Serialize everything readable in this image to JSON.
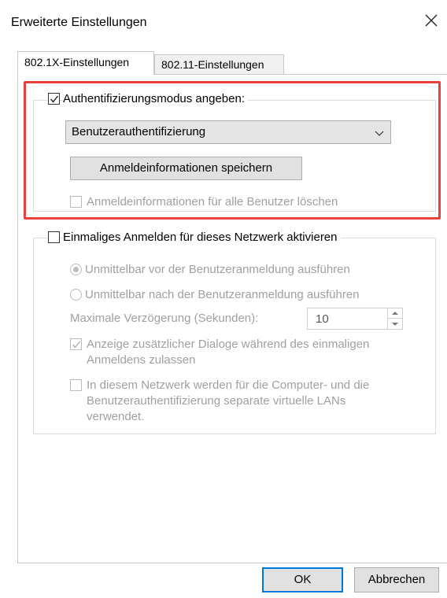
{
  "window": {
    "title": "Erweiterte Einstellungen"
  },
  "tabs": [
    {
      "label": "802.1X-Einstellungen",
      "selected": true
    },
    {
      "label": "802.11-Einstellungen",
      "selected": false
    }
  ],
  "auth_group": {
    "checkbox_label": "Authentifizierungsmodus angeben:",
    "checked": true,
    "mode_select_value": "Benutzerauthentifizierung",
    "save_button_label": "Anmeldeinformationen speichern",
    "delete_checkbox_label": "Anmeldeinformationen für alle Benutzer löschen",
    "delete_checked": false
  },
  "sso_group": {
    "checkbox_label": "Einmaliges Anmelden für dieses Netzwerk aktivieren",
    "checked": false,
    "radio_before_label": "Unmittelbar vor der Benutzeranmeldung ausführen",
    "radio_before_selected": true,
    "radio_after_label": "Unmittelbar nach der Benutzeranmeldung ausführen",
    "radio_after_selected": false,
    "delay_label": "Maximale Verzögerung (Sekunden):",
    "delay_value": "10",
    "dialogs_checkbox_label_line1": "Anzeige zusätzlicher Dialoge während des einmaligen",
    "dialogs_checkbox_label_line2": "Anmeldens zulassen",
    "dialogs_checked": true,
    "vlan_checkbox_label_line1": "In diesem Netzwerk werden für die Computer- und die",
    "vlan_checkbox_label_line2": "Benutzerauthentifizierung separate virtuelle LANs",
    "vlan_checkbox_label_line3": "verwendet.",
    "vlan_checked": false
  },
  "footer": {
    "ok_label": "OK",
    "cancel_label": "Abbrechen"
  },
  "colors": {
    "highlight": "#e8413e",
    "default_button_border": "#0078d7"
  }
}
